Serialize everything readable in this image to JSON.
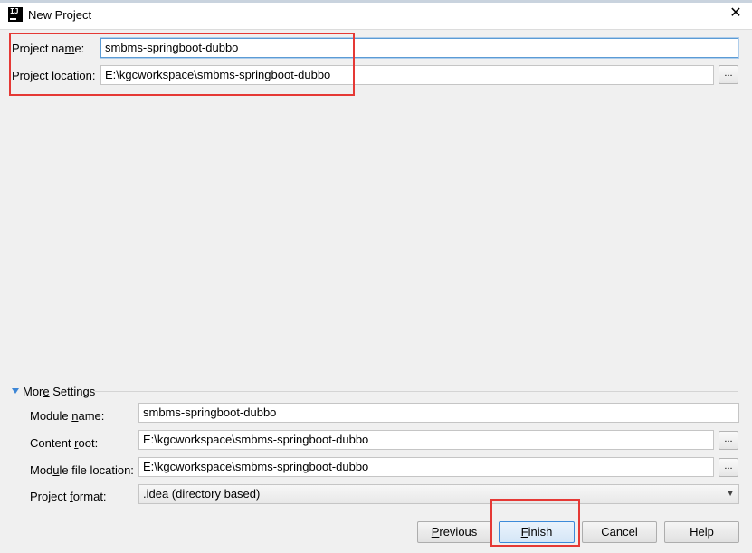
{
  "window": {
    "title": "New Project",
    "app_icon_text": "IJ"
  },
  "project": {
    "name_label_pre": "Project na",
    "name_label_u": "m",
    "name_label_post": "e:",
    "name_value": "smbms-springboot-dubbo",
    "location_label_pre": "Project ",
    "location_label_u": "l",
    "location_label_post": "ocation:",
    "location_value": "E:\\kgcworkspace\\smbms-springboot-dubbo",
    "browse_label": "..."
  },
  "more_settings": {
    "toggle_label_pre": "Mor",
    "toggle_label_u": "e",
    "toggle_label_post": " Settings",
    "module_name_label_pre": "Module ",
    "module_name_label_u": "n",
    "module_name_label_post": "ame:",
    "module_name_value": "smbms-springboot-dubbo",
    "content_root_label_pre": "Content ",
    "content_root_label_u": "r",
    "content_root_label_post": "oot:",
    "content_root_value": "E:\\kgcworkspace\\smbms-springboot-dubbo",
    "module_file_label_pre": "Mod",
    "module_file_label_u": "u",
    "module_file_label_post": "le file location:",
    "module_file_value": "E:\\kgcworkspace\\smbms-springboot-dubbo",
    "project_format_label_pre": "Project ",
    "project_format_label_u": "f",
    "project_format_label_post": "ormat:",
    "project_format_value": ".idea (directory based)",
    "browse_label": "..."
  },
  "buttons": {
    "previous_u": "P",
    "previous_rest": "revious",
    "finish_u": "F",
    "finish_rest": "inish",
    "cancel": "Cancel",
    "help": "Help"
  },
  "colors": {
    "highlight": "#e53935",
    "accent": "#3c8ad9"
  }
}
